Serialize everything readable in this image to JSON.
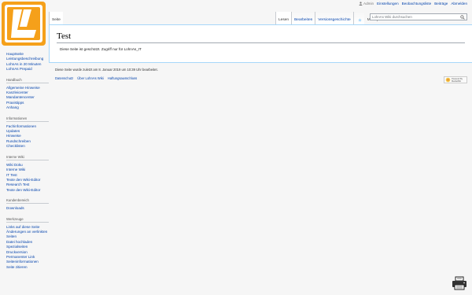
{
  "personal_tools": {
    "user": "Admin",
    "items": [
      "Einstellungen",
      "Beobachtungsliste",
      "Beiträge",
      "Abmelden"
    ]
  },
  "tabs_left": [
    "Seite"
  ],
  "tabs_right": {
    "read": "Lesen",
    "edit": "Bearbeiten",
    "history": "Versionsgeschichte",
    "more": "Mehr"
  },
  "search": {
    "placeholder": "LohnAs Wiki durchsuchen"
  },
  "page": {
    "title": "Test",
    "body": "Diese Seite ist geschützt. Zugriff nur für LohnAs_IT"
  },
  "footer": {
    "lastmod": "Diese Seite wurde zuletzt am 8. Januar 2019 um 10:39 Uhr bearbeitet.",
    "links": [
      "Datenschutz",
      "Über LohnAs Wiki",
      "Haftungsausschluss"
    ],
    "powered": [
      "Powered By",
      "MediaWiki"
    ]
  },
  "sidebar": {
    "main": [
      "Hauptseite",
      "Leistungsbeschreibung",
      "LohnAs in 20 Minuten",
      "LohnAs Prepaid"
    ],
    "portals": [
      {
        "heading": "Handbuch",
        "items": [
          "Allgemeine Hinweise",
          "Kanzleicenter",
          "Mandantencenter",
          "Praxistipps",
          "Anhang"
        ]
      },
      {
        "heading": "Informationen",
        "items": [
          "Fachinformationen",
          "Updates",
          "Hinweise",
          "Rundschreiben",
          "Checklisten"
        ]
      },
      {
        "heading": "Interne Wiki",
        "items": [
          "Wiki Doku",
          "Interne Wiki",
          "IT Test",
          "Texte den Wiki-Editor",
          "Research Test",
          "Texte den Wiki-Editor"
        ]
      },
      {
        "heading": "Kundenbereich",
        "items": [
          "Downloads"
        ]
      },
      {
        "heading": "Werkzeuge",
        "items": [
          "Links auf diese Seite",
          "Änderungen an verlinkten Seiten",
          "Datei hochladen",
          "Spezialseiten",
          "Druckversion",
          "Permanenter Link",
          "Seiteninformationen",
          "Seite zitieren"
        ]
      }
    ]
  },
  "colors": {
    "logo_orange": "#f5a01a",
    "link": "#0645ad"
  },
  "icons": {
    "user": "user-icon",
    "search": "search-icon",
    "watch": "star-icon",
    "print": "printer-icon"
  }
}
